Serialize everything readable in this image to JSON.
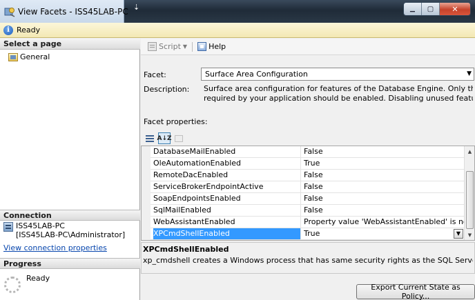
{
  "window": {
    "title": "View Facets - ISS45LAB-PC",
    "pin_glyph": "⇣",
    "minimize_glyph": "▁",
    "maximize_glyph": "▢",
    "close_glyph": "✕"
  },
  "status": {
    "text": "Ready",
    "icon": "info-icon",
    "icon_glyph": "i"
  },
  "left": {
    "select_page_header": "Select a page",
    "pages": [
      {
        "label": "General",
        "icon": "properties-page-icon"
      }
    ],
    "connection_header": "Connection",
    "connection_server": "ISS45LAB-PC",
    "connection_user": "[ISS45LAB-PC\\Administrator]",
    "connection_link": "View connection properties",
    "progress_header": "Progress",
    "progress_status": "Ready"
  },
  "toolbar": {
    "script_label": "Script",
    "script_caret": "▼",
    "help_label": "Help"
  },
  "facet": {
    "label": "Facet:",
    "selected": "Surface Area Configuration",
    "dropdown_glyph": "▼",
    "description_label": "Description:",
    "description_line1": "Surface area configuration for features of the Database Engine. Only the features",
    "description_line2": "required by your application should be enabled. Disabling unused features helps"
  },
  "properties": {
    "label": "Facet properties:",
    "sort_glyph": "A↓Z",
    "rows": [
      {
        "name": "DatabaseMailEnabled",
        "value": "False"
      },
      {
        "name": "OleAutomationEnabled",
        "value": "True"
      },
      {
        "name": "RemoteDacEnabled",
        "value": "False"
      },
      {
        "name": "ServiceBrokerEndpointActive",
        "value": "False"
      },
      {
        "name": "SoapEndpointsEnabled",
        "value": "False"
      },
      {
        "name": "SqlMailEnabled",
        "value": "False"
      },
      {
        "name": "WebAssistantEnabled",
        "value": "Property value 'WebAssistantEnabled' is not available"
      },
      {
        "name": "XPCmdShellEnabled",
        "value": "True"
      }
    ],
    "selected_index": 7,
    "value_drop_glyph": "▼",
    "scroll_up_glyph": "▲",
    "scroll_down_glyph": "▼"
  },
  "property_description": {
    "title": "XPCmdShellEnabled",
    "text": "xp_cmdshell creates a Windows process that has same security rights as the SQL Server service."
  },
  "buttons": {
    "export": "Export Current State as Policy..."
  },
  "colors": {
    "selection": "#3399ff",
    "link": "#0645ad"
  }
}
